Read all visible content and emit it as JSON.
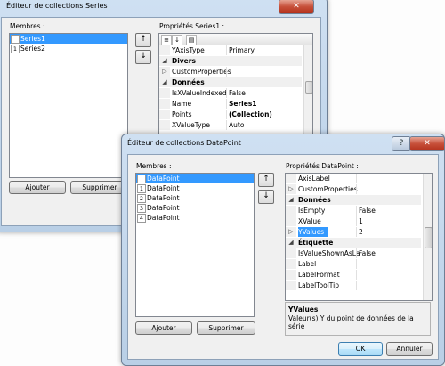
{
  "series_dialog": {
    "title": "Éditeur de collections Series",
    "members_label": "Membres :",
    "members": [
      {
        "index": "0",
        "label": "Series1",
        "selected": true
      },
      {
        "index": "1",
        "label": "Series2",
        "selected": false
      }
    ],
    "props_label": "Propriétés Series1 :",
    "add_label": "Ajouter",
    "remove_label": "Supprimer",
    "properties": [
      {
        "name": "YAxisType",
        "value": "Primary",
        "kind": "prop"
      },
      {
        "name": "Divers",
        "value": "",
        "kind": "cat"
      },
      {
        "name": "CustomProperties",
        "value": "",
        "kind": "expand"
      },
      {
        "name": "Données",
        "value": "",
        "kind": "cat"
      },
      {
        "name": "IsXValueIndexed",
        "value": "False",
        "kind": "prop"
      },
      {
        "name": "Name",
        "value": "Series1",
        "kind": "bold"
      },
      {
        "name": "Points",
        "value": "(Collection)",
        "kind": "bold"
      },
      {
        "name": "XValueType",
        "value": "Auto",
        "kind": "prop"
      }
    ],
    "close_glyph": "✕"
  },
  "datapoint_dialog": {
    "title": "Éditeur de collections DataPoint",
    "help_glyph": "?",
    "close_glyph": "✕",
    "members_label": "Membres :",
    "members": [
      {
        "index": "0",
        "label": "DataPoint",
        "selected": true
      },
      {
        "index": "1",
        "label": "DataPoint",
        "selected": false
      },
      {
        "index": "2",
        "label": "DataPoint",
        "selected": false
      },
      {
        "index": "3",
        "label": "DataPoint",
        "selected": false
      },
      {
        "index": "4",
        "label": "DataPoint",
        "selected": false
      }
    ],
    "props_label": "Propriétés DataPoint :",
    "properties": [
      {
        "name": "AxisLabel",
        "value": "",
        "kind": "prop"
      },
      {
        "name": "CustomProperties",
        "value": "",
        "kind": "expand"
      },
      {
        "name": "Données",
        "value": "",
        "kind": "cat"
      },
      {
        "name": "IsEmpty",
        "value": "False",
        "kind": "prop"
      },
      {
        "name": "XValue",
        "value": "1",
        "kind": "prop"
      },
      {
        "name": "YValues",
        "value": "2",
        "kind": "selected"
      },
      {
        "name": "Étiquette",
        "value": "",
        "kind": "cat"
      },
      {
        "name": "IsValueShownAsLa",
        "value": "False",
        "kind": "prop"
      },
      {
        "name": "Label",
        "value": "",
        "kind": "prop"
      },
      {
        "name": "LabelFormat",
        "value": "",
        "kind": "prop"
      },
      {
        "name": "LabelToolTip",
        "value": "",
        "kind": "prop"
      }
    ],
    "desc_title": "YValues",
    "desc_text": "Valeur(s) Y du point de données de la série",
    "add_label": "Ajouter",
    "remove_label": "Supprimer",
    "ok_label": "OK",
    "cancel_label": "Annuler",
    "up_glyph": "🡅",
    "down_glyph": "🡇"
  }
}
